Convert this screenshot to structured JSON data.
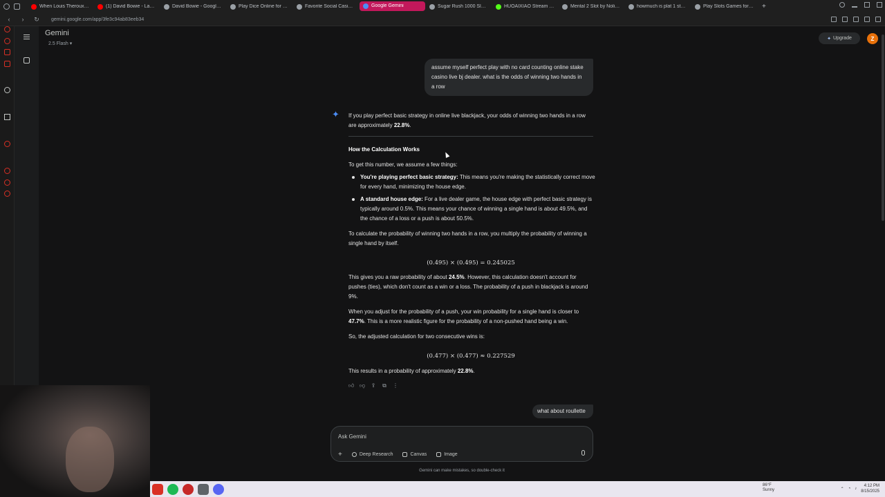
{
  "browser": {
    "tabs": [
      {
        "label": "When Louis Theroux Met",
        "color": "#ff0000"
      },
      {
        "label": "(1) David Bowie - Lazarus",
        "color": "#ff0000"
      },
      {
        "label": "David Bowie - Google Se",
        "color": "#9aa0a6"
      },
      {
        "label": "Play Dice Online for Fun",
        "color": "#9aa0a6"
      },
      {
        "label": "Favorite Social Casino G",
        "color": "#9aa0a6"
      },
      {
        "label": "Google Gemini",
        "color": "#4c8df6",
        "active": true
      },
      {
        "label": "Sugar Rush 1000 Slot by",
        "color": "#9aa0a6"
      },
      {
        "label": "HUOAIXIAO Stream - Wat",
        "color": "#53fc18"
      },
      {
        "label": "Mental 2 Slot by Nolimit",
        "color": "#9aa0a6"
      },
      {
        "label": "howmuch is plat 1 stake",
        "color": "#9aa0a6"
      },
      {
        "label": "Play Slots Games for Free",
        "color": "#9aa0a6"
      }
    ],
    "new_tab": "+",
    "url": "gemini.google.com/app/3fe3c94ab83eeb34"
  },
  "header": {
    "title": "Gemini",
    "model": "2.5 Flash",
    "upgrade_label": "Upgrade",
    "avatar_letter": "Z"
  },
  "chat": {
    "user_msg_1": "assume myself perfect play with no card counting online stake casino live bj dealer. what is the odds of winning two hands in a row",
    "resp_intro_pre": "If you play perfect basic strategy in online live blackjack, your odds of winning two hands in a row are approximately ",
    "resp_intro_value": "22.8%",
    "resp_intro_post": ".",
    "section_heading": "How the Calculation Works",
    "assume_line": "To get this number, we assume a few things:",
    "bullet_1_bold": "You're playing perfect basic strategy:",
    "bullet_1_text": " This means you're making the statistically correct move for every hand, minimizing the house edge.",
    "bullet_2_bold": "A standard house edge:",
    "bullet_2_text": " For a live dealer game, the house edge with perfect basic strategy is typically around 0.5%. This means your chance of winning a single hand is about 49.5%, and the chance of a loss or a push is about 50.5%.",
    "calc_line": "To calculate the probability of winning two hands in a row, you multiply the probability of winning a single hand by itself.",
    "math_1": "(0.495) × (0.495) = 0.245025",
    "raw_pre": "This gives you a raw probability of about ",
    "raw_value": "24.5%",
    "raw_post": ". However, this calculation doesn't account for pushes (ties), which don't count as a win or a loss. The probability of a push in blackjack is around 9%.",
    "adjust_pre": "When you adjust for the probability of a push, your win probability for a single hand is closer to ",
    "adjust_value": "47.7%",
    "adjust_post": ". This is a more realistic figure for the probability of a non-pushed hand being a win.",
    "adjusted_line": "So, the adjusted calculation for two consecutive wins is:",
    "math_2": "(0.477) × (0.477) ≈ 0.227529",
    "result_pre": "This results in a probability of approximately ",
    "result_value": "22.8%",
    "result_post": ".",
    "user_msg_2": "what about roullette"
  },
  "input": {
    "placeholder": "Ask Gemini",
    "add_label": "+",
    "deep_research": "Deep Research",
    "canvas": "Canvas",
    "image": "Image",
    "disclaimer": "Gemini can make mistakes, so double-check it"
  },
  "taskbar": {
    "weather_temp": "86°F",
    "weather_desc": "Sunny",
    "time": "4:12 PM",
    "date": "8/15/2025"
  },
  "colors": {
    "accent": "#4c8df6",
    "active_tab": "#c2185b",
    "avatar": "#e8710a"
  }
}
